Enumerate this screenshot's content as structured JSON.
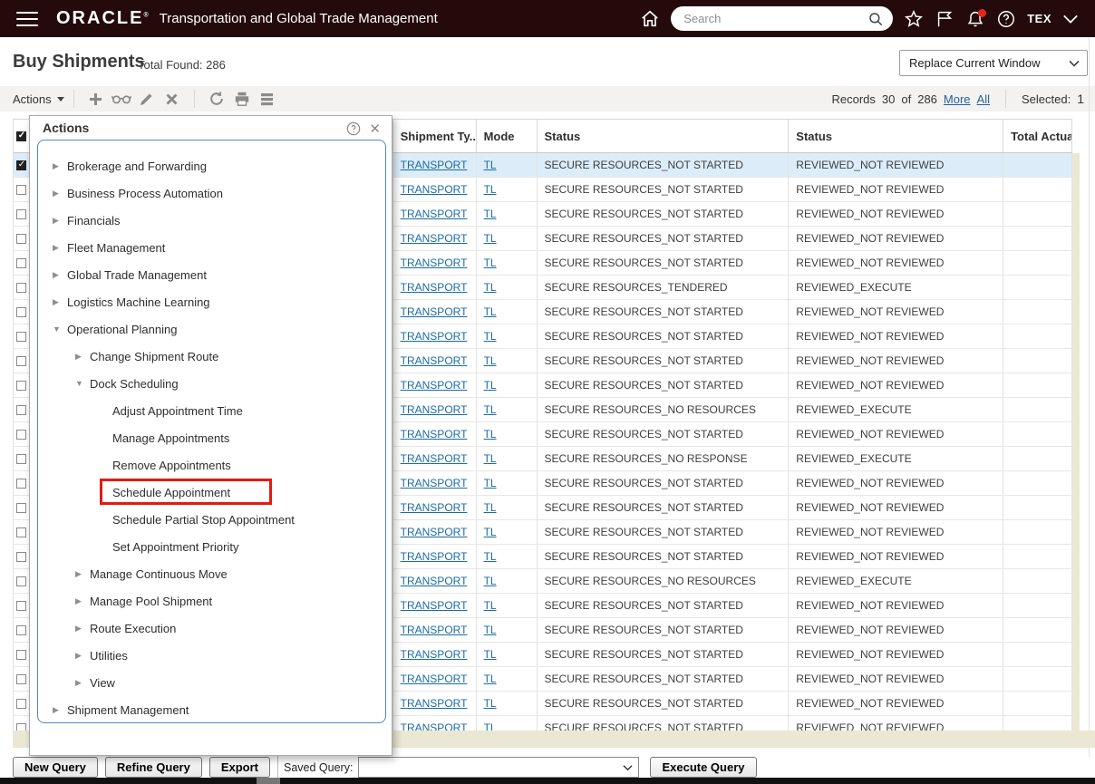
{
  "topbar": {
    "logo": "ORACLE",
    "app_title": "Transportation and Global Trade Management",
    "search_placeholder": "Search",
    "user": "TEX",
    "icons": [
      "menu-icon",
      "home-icon",
      "search-icon",
      "star-icon",
      "flag-icon",
      "bell-icon",
      "help-icon",
      "chevron-down-icon"
    ]
  },
  "page": {
    "title": "Buy Shipments",
    "total_found": "Total Found: 286",
    "window_mode": "Replace Current Window"
  },
  "toolbar": {
    "actions_label": "Actions",
    "icons": [
      "add-icon",
      "view-glasses-icon",
      "edit-pencil-icon",
      "delete-x-icon",
      "refresh-icon",
      "print-icon",
      "rows-icon"
    ],
    "records_label": "Records",
    "records_count": "30",
    "of_label": "of",
    "records_total": "286",
    "more_link": "More",
    "all_link": "All",
    "selected_label": "Selected:",
    "selected_value": "1"
  },
  "actions_menu": {
    "title": "Actions",
    "items": [
      {
        "label": "Brokerage and Forwarding",
        "level": 1,
        "state": "collapsed"
      },
      {
        "label": "Business Process Automation",
        "level": 1,
        "state": "collapsed"
      },
      {
        "label": "Financials",
        "level": 1,
        "state": "collapsed"
      },
      {
        "label": "Fleet Management",
        "level": 1,
        "state": "collapsed"
      },
      {
        "label": "Global Trade Management",
        "level": 1,
        "state": "collapsed"
      },
      {
        "label": "Logistics Machine Learning",
        "level": 1,
        "state": "collapsed"
      },
      {
        "label": "Operational Planning",
        "level": 1,
        "state": "expanded"
      },
      {
        "label": "Change Shipment Route",
        "level": 2,
        "state": "collapsed"
      },
      {
        "label": "Dock Scheduling",
        "level": 2,
        "state": "expanded"
      },
      {
        "label": "Adjust Appointment Time",
        "level": 3,
        "state": "leaf"
      },
      {
        "label": "Manage Appointments",
        "level": 3,
        "state": "leaf"
      },
      {
        "label": "Remove Appointments",
        "level": 3,
        "state": "leaf"
      },
      {
        "label": "Schedule Appointment",
        "level": 3,
        "state": "leaf",
        "highlighted": true
      },
      {
        "label": "Schedule Partial Stop Appointment",
        "level": 3,
        "state": "leaf"
      },
      {
        "label": "Set Appointment Priority",
        "level": 3,
        "state": "leaf"
      },
      {
        "label": "Manage Continuous Move",
        "level": 2,
        "state": "collapsed"
      },
      {
        "label": "Manage Pool Shipment",
        "level": 2,
        "state": "collapsed"
      },
      {
        "label": "Route Execution",
        "level": 2,
        "state": "collapsed"
      },
      {
        "label": "Utilities",
        "level": 2,
        "state": "collapsed"
      },
      {
        "label": "View",
        "level": 2,
        "state": "collapsed"
      },
      {
        "label": "Shipment Management",
        "level": 1,
        "state": "collapsed"
      }
    ]
  },
  "table": {
    "columns": [
      "",
      "",
      "Shipment Ty...",
      "Mode",
      "Status",
      "Status",
      "Total Actual"
    ],
    "rows": [
      {
        "type": "TRANSPORT",
        "mode": "TL",
        "status1": "SECURE RESOURCES_NOT STARTED",
        "status2": "REVIEWED_NOT REVIEWED",
        "total": "",
        "selected": true,
        "checked": true
      },
      {
        "type": "TRANSPORT",
        "mode": "TL",
        "status1": "SECURE RESOURCES_NOT STARTED",
        "status2": "REVIEWED_NOT REVIEWED",
        "total": ""
      },
      {
        "type": "TRANSPORT",
        "mode": "TL",
        "status1": "SECURE RESOURCES_NOT STARTED",
        "status2": "REVIEWED_NOT REVIEWED",
        "total": ""
      },
      {
        "type": "TRANSPORT",
        "mode": "TL",
        "status1": "SECURE RESOURCES_NOT STARTED",
        "status2": "REVIEWED_NOT REVIEWED",
        "total": ""
      },
      {
        "type": "TRANSPORT",
        "mode": "TL",
        "status1": "SECURE RESOURCES_NOT STARTED",
        "status2": "REVIEWED_NOT REVIEWED",
        "total": ""
      },
      {
        "type": "TRANSPORT",
        "mode": "TL",
        "status1": "SECURE RESOURCES_TENDERED",
        "status2": "REVIEWED_EXECUTE",
        "total": ""
      },
      {
        "type": "TRANSPORT",
        "mode": "TL",
        "status1": "SECURE RESOURCES_NOT STARTED",
        "status2": "REVIEWED_NOT REVIEWED",
        "total": ""
      },
      {
        "type": "TRANSPORT",
        "mode": "TL",
        "status1": "SECURE RESOURCES_NOT STARTED",
        "status2": "REVIEWED_NOT REVIEWED",
        "total": ""
      },
      {
        "type": "TRANSPORT",
        "mode": "TL",
        "status1": "SECURE RESOURCES_NOT STARTED",
        "status2": "REVIEWED_NOT REVIEWED",
        "total": ""
      },
      {
        "type": "TRANSPORT",
        "mode": "TL",
        "status1": "SECURE RESOURCES_NOT STARTED",
        "status2": "REVIEWED_NOT REVIEWED",
        "total": ""
      },
      {
        "type": "TRANSPORT",
        "mode": "TL",
        "status1": "SECURE RESOURCES_NO RESOURCES",
        "status2": "REVIEWED_EXECUTE",
        "total": ""
      },
      {
        "type": "TRANSPORT",
        "mode": "TL",
        "status1": "SECURE RESOURCES_NOT STARTED",
        "status2": "REVIEWED_NOT REVIEWED",
        "total": ""
      },
      {
        "type": "TRANSPORT",
        "mode": "TL",
        "status1": "SECURE RESOURCES_NO RESPONSE",
        "status2": "REVIEWED_EXECUTE",
        "total": ""
      },
      {
        "type": "TRANSPORT",
        "mode": "TL",
        "status1": "SECURE RESOURCES_NOT STARTED",
        "status2": "REVIEWED_NOT REVIEWED",
        "total": ""
      },
      {
        "type": "TRANSPORT",
        "mode": "TL",
        "status1": "SECURE RESOURCES_NOT STARTED",
        "status2": "REVIEWED_NOT REVIEWED",
        "total": ""
      },
      {
        "type": "TRANSPORT",
        "mode": "TL",
        "status1": "SECURE RESOURCES_NOT STARTED",
        "status2": "REVIEWED_NOT REVIEWED",
        "total": ""
      },
      {
        "type": "TRANSPORT",
        "mode": "TL",
        "status1": "SECURE RESOURCES_NOT STARTED",
        "status2": "REVIEWED_NOT REVIEWED",
        "total": ""
      },
      {
        "type": "TRANSPORT",
        "mode": "TL",
        "status1": "SECURE RESOURCES_NO RESOURCES",
        "status2": "REVIEWED_EXECUTE",
        "total": ""
      },
      {
        "type": "TRANSPORT",
        "mode": "TL",
        "status1": "SECURE RESOURCES_NOT STARTED",
        "status2": "REVIEWED_NOT REVIEWED",
        "total": ""
      },
      {
        "type": "TRANSPORT",
        "mode": "TL",
        "status1": "SECURE RESOURCES_NOT STARTED",
        "status2": "REVIEWED_NOT REVIEWED",
        "total": ""
      },
      {
        "type": "TRANSPORT",
        "mode": "TL",
        "status1": "SECURE RESOURCES_NOT STARTED",
        "status2": "REVIEWED_NOT REVIEWED",
        "total": ""
      },
      {
        "type": "TRANSPORT",
        "mode": "TL",
        "status1": "SECURE RESOURCES_NOT STARTED",
        "status2": "REVIEWED_NOT REVIEWED",
        "total": ""
      },
      {
        "type": "TRANSPORT",
        "mode": "TL",
        "status1": "SECURE RESOURCES_NOT STARTED",
        "status2": "REVIEWED_NOT REVIEWED",
        "total": ""
      },
      {
        "type": "TRANSPORT",
        "mode": "TL",
        "status1": "SECURE RESOURCES_NOT STARTED",
        "status2": "REVIEWED_NOT REVIEWED",
        "total": ""
      }
    ]
  },
  "query_bar": {
    "new_query": "New Query",
    "refine_query": "Refine Query",
    "export": "Export",
    "saved_query_label": "Saved Query:",
    "saved_query_value": "",
    "execute_query": "Execute Query"
  },
  "colors": {
    "topbar_bg": "#250a0b",
    "highlight_red": "#e11b12",
    "selected_row": "#dcedf9",
    "link_blue": "#1c6ba5",
    "scrollbar_beige": "#eae7d3"
  }
}
